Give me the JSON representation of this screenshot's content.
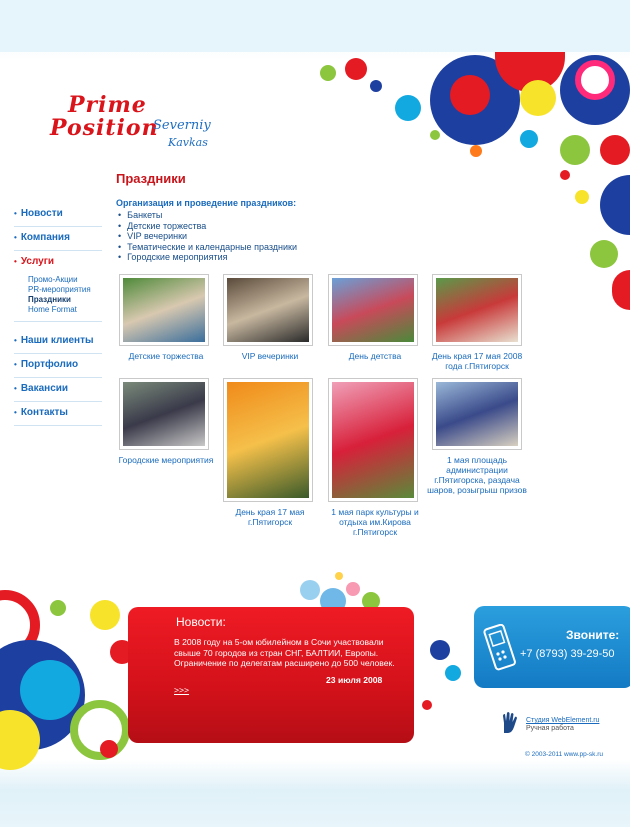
{
  "logo": {
    "line1": "Prime",
    "line2": "Position",
    "line3": "Severniy",
    "line4": "Kavkas"
  },
  "nav": {
    "items": [
      {
        "label": "Новости"
      },
      {
        "label": "Компания"
      },
      {
        "label": "Услуги"
      },
      {
        "label": "Наши клиенты"
      },
      {
        "label": "Портфолио"
      },
      {
        "label": "Вакансии"
      },
      {
        "label": "Контакты"
      }
    ],
    "subitems": [
      {
        "label": "Промо-Акции"
      },
      {
        "label": "PR-мероприятия"
      },
      {
        "label": "Праздники"
      },
      {
        "label": "Home Format"
      }
    ]
  },
  "main": {
    "title": "Праздники",
    "intro": "Организация и проведение праздников:",
    "list": [
      "Банкеты",
      "Детские торжества",
      "VIP вечеринки",
      "Тематические и календарные праздники",
      "Городские мероприятия"
    ],
    "gallery": [
      {
        "caption": "Детские торжества",
        "colors": [
          "#4f8a3a",
          "#d8c8b0",
          "#3a6e9c"
        ]
      },
      {
        "caption": "VIP вечеринки",
        "colors": [
          "#5a4a3a",
          "#c8b8a0",
          "#2a2a2a"
        ]
      },
      {
        "caption": "День детства",
        "colors": [
          "#6aa0d8",
          "#c84a5a",
          "#4a8a3a"
        ]
      },
      {
        "caption": "День края 17 мая 2008 года г.Пятигорск",
        "colors": [
          "#5a9a4a",
          "#c83a3a",
          "#e8e0d0"
        ]
      },
      {
        "caption": "Городские мероприятия",
        "colors": [
          "#7a8a7a",
          "#3a3a4a",
          "#c8c8c8"
        ]
      },
      {
        "caption": "День края 17 мая г.Пятигорск",
        "colors": [
          "#f08a1a",
          "#f5c04a",
          "#3a5a2a"
        ]
      },
      {
        "caption": "1 мая парк культуры и отдыха им.Кирова г.Пятигорск",
        "colors": [
          "#f0a0b8",
          "#d8203a",
          "#5a8a3a"
        ]
      },
      {
        "caption": "1 мая площадь администрации г.Пятигорска, раздача шаров, розыгрыш призов",
        "colors": [
          "#9ab8d8",
          "#3a4a8a",
          "#d8d0c0"
        ]
      }
    ]
  },
  "news": {
    "title": "Новости:",
    "text": "В 2008 году на 5-ом юбилейном в Сочи участвовали свыше 70 городов из стран СНГ, БАЛТИИ, Европы. Ограничение по делегатам расширено до 500 человек.",
    "date": "23 июля 2008",
    "more": ">>>"
  },
  "call": {
    "title": "Звоните:",
    "phone": "+7 (8793) 39-29-50"
  },
  "footer": {
    "studio": "Студия WebElement.ru",
    "handmade": "Ручная работа",
    "copyright": "© 2003-2011 www.pp-sk.ru"
  },
  "colors": {
    "accent_red": "#d9141b",
    "link_blue": "#1a6bbd",
    "call_blue": "#1f8ad3"
  }
}
